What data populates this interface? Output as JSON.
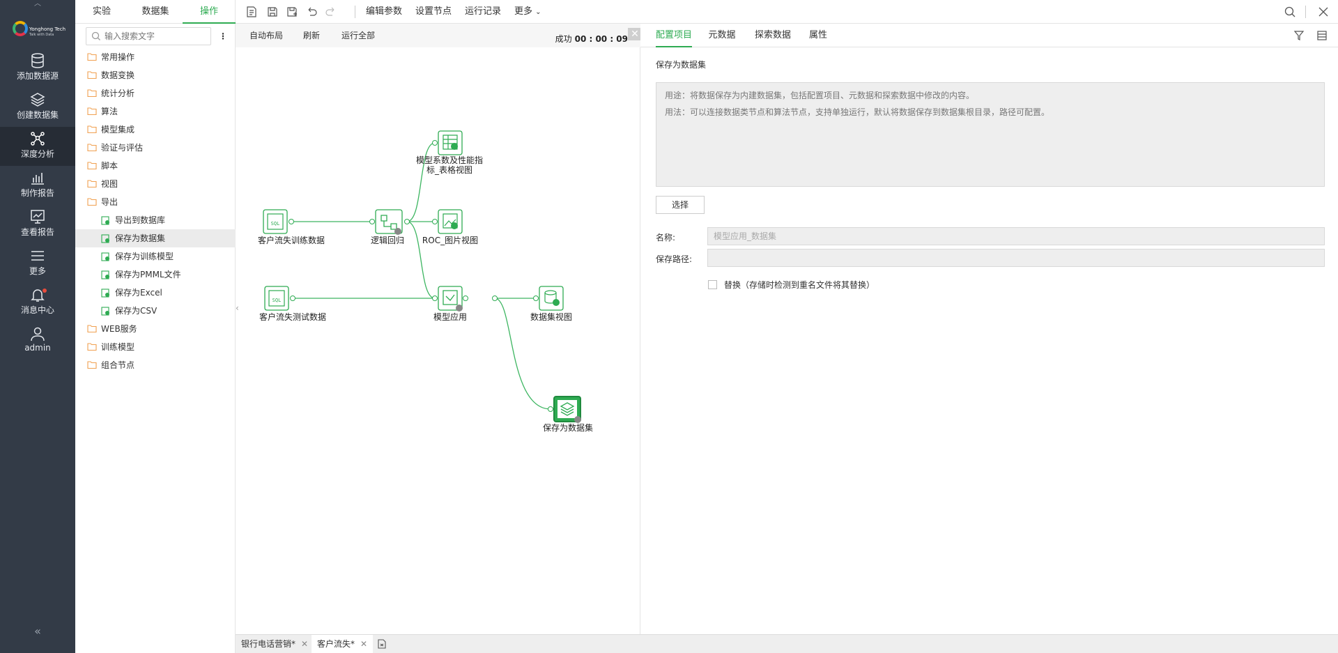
{
  "leftnav": {
    "logo": {
      "brand": "Yonghong Tech",
      "slogan": "Talk with Data"
    },
    "items": [
      {
        "label": "添加数据源",
        "icon": "database-icon"
      },
      {
        "label": "创建数据集",
        "icon": "layers-icon"
      },
      {
        "label": "深度分析",
        "icon": "network-icon",
        "active": true
      },
      {
        "label": "制作报告",
        "icon": "bar-chart-icon"
      },
      {
        "label": "查看报告",
        "icon": "monitor-chart-icon"
      },
      {
        "label": "更多",
        "icon": "menu-icon"
      },
      {
        "label": "消息中心",
        "icon": "bell-icon",
        "badge": true
      },
      {
        "label": "admin",
        "icon": "user-icon"
      }
    ],
    "collapse": "«"
  },
  "tree": {
    "tabs": [
      "实验",
      "数据集",
      "操作"
    ],
    "active_tab": "操作",
    "search_placeholder": "输入搜索文字",
    "folders": [
      {
        "label": "常用操作"
      },
      {
        "label": "数据变换"
      },
      {
        "label": "统计分析"
      },
      {
        "label": "算法"
      },
      {
        "label": "模型集成"
      },
      {
        "label": "验证与评估"
      },
      {
        "label": "脚本"
      },
      {
        "label": "视图"
      },
      {
        "label": "导出",
        "expanded": true
      }
    ],
    "export_children": [
      {
        "label": "导出到数据库"
      },
      {
        "label": "保存为数据集",
        "selected": true
      },
      {
        "label": "保存为训练模型"
      },
      {
        "label": "保存为PMML文件"
      },
      {
        "label": "保存为Excel"
      },
      {
        "label": "保存为CSV"
      }
    ],
    "folders_after": [
      {
        "label": "WEB服务"
      },
      {
        "label": "训练模型"
      },
      {
        "label": "组合节点"
      }
    ]
  },
  "toolbar": {
    "icons": [
      "new-experiment-icon",
      "save-icon",
      "save-as-icon",
      "undo-icon",
      "redo-icon"
    ],
    "edit_params": "编辑参数",
    "set_node": "设置节点",
    "run_log": "运行记录",
    "more": "更多",
    "right_icons": [
      "search-icon",
      "close-icon"
    ]
  },
  "canvasbar": {
    "auto_layout": "自动布局",
    "refresh": "刷新",
    "run_all": "运行全部",
    "status_label": "成功",
    "status_time": "00 : 00 : 09"
  },
  "canvas": {
    "nodes": [
      {
        "id": "train",
        "label": "客户流失训练数据"
      },
      {
        "id": "test",
        "label": "客户流失测试数据"
      },
      {
        "id": "logreg",
        "label": "逻辑回归"
      },
      {
        "id": "coef_l1",
        "label": "模型系数及性能指"
      },
      {
        "id": "coef_l2",
        "label": "标_表格视图"
      },
      {
        "id": "roc",
        "label": "ROC_图片视图"
      },
      {
        "id": "apply",
        "label": "模型应用"
      },
      {
        "id": "dsview",
        "label": "数据集视图"
      },
      {
        "id": "save",
        "label": "保存为数据集"
      }
    ]
  },
  "rpanel": {
    "tabs": [
      "配置项目",
      "元数据",
      "探索数据",
      "属性"
    ],
    "active_tab": "配置项目",
    "title": "保存为数据集",
    "desc_line1": "用途：将数据保存为内建数据集，包括配置项目、元数据和探索数据中修改的内容。",
    "desc_line2": "用法：可以连接数据类节点和算法节点，支持单独运行，默认将数据保存到数据集根目录，路径可配置。",
    "choose_button": "选择",
    "name_label": "名称:",
    "name_placeholder": "模型应用_数据集",
    "path_label": "保存路径:",
    "path_value": "",
    "replace_label": "替换（存储时检测到重名文件将其替换）"
  },
  "bottom": {
    "tabs": [
      {
        "label": "银行电话营销*"
      },
      {
        "label": "客户流失*",
        "active": true
      }
    ]
  },
  "colors": {
    "accent": "#2eab52",
    "nav_bg": "#333b47",
    "folder": "#f0a050"
  }
}
